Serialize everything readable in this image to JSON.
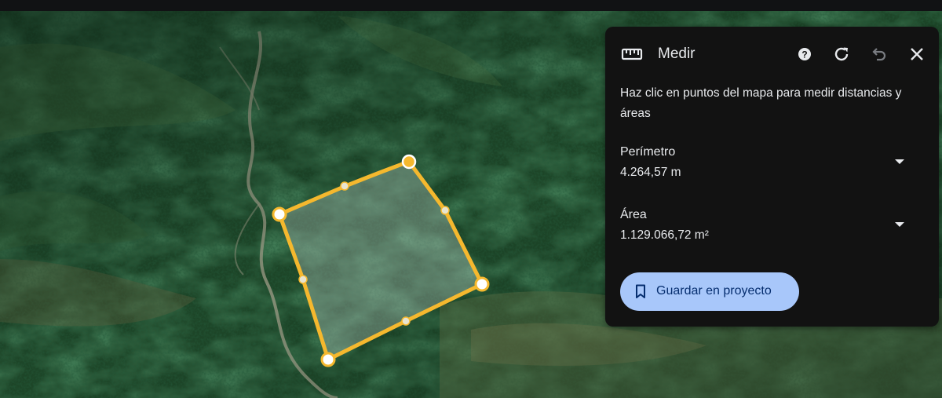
{
  "panel": {
    "title": "Medir",
    "instructions": "Haz clic en puntos del mapa para medir distancias y áreas",
    "perimeter": {
      "label": "Perímetro",
      "value": "4.264,57 m"
    },
    "area": {
      "label": "Área",
      "value": "1.129.066,72 m²"
    },
    "save_button": "Guardar en proyecto",
    "header_icons": [
      "ruler-icon",
      "help-icon",
      "refresh-icon",
      "undo-icon",
      "close-icon"
    ]
  },
  "map": {
    "view": "satellite-3d",
    "measurement_color": "#f5b82e"
  },
  "colors": {
    "panel_bg": "#121212",
    "button_bg": "#a8c7fa",
    "button_text": "#062e6f"
  }
}
